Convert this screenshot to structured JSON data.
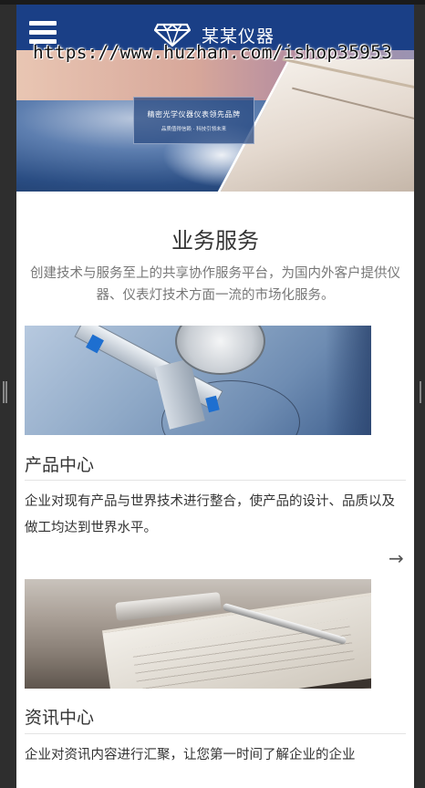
{
  "header": {
    "brand_name": "某某仪器",
    "logo_icon": "diamond-icon",
    "menu_icon": "hamburger-menu-icon",
    "background_color": "#1a3f86"
  },
  "watermark": {
    "text": "https://www.huzhan.com/ishop35953"
  },
  "banner": {
    "headline": "精密光学仪器仪表领先品牌",
    "subline": "品质值得信赖 · 科技引领未来"
  },
  "services": {
    "title": "业务服务",
    "description": "创建技术与服务至上的共享协作服务平台，为国内外客户提供仪器、仪表灯技术方面一流的市场化服务。"
  },
  "cards": [
    {
      "image": "caliper-photo",
      "title": "产品中心",
      "description": "企业对现有产品与世界技术进行整合，使产品的设计、品质以及做工均达到世界水平。",
      "link_icon": "arrow-right-icon",
      "link_text": "→"
    },
    {
      "image": "notebook-pen-photo",
      "title": "资讯中心",
      "description": "企业对资讯内容进行汇聚，让您第一时间了解企业的企业"
    }
  ]
}
